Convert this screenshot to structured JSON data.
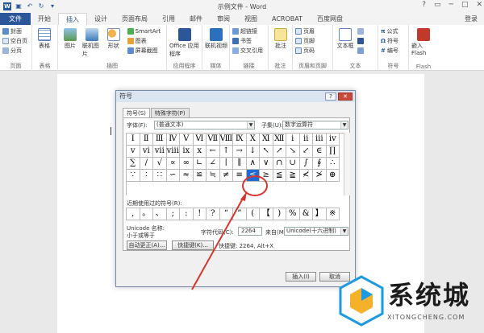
{
  "window": {
    "title": "示例文件 - Word",
    "login": "登录",
    "controls": [
      "?",
      "─",
      "□",
      "✕"
    ]
  },
  "tabs": [
    {
      "label": "文件",
      "kind": "file"
    },
    {
      "label": "开始",
      "kind": "normal"
    },
    {
      "label": "插入",
      "kind": "active"
    },
    {
      "label": "设计",
      "kind": "normal"
    },
    {
      "label": "页面布局",
      "kind": "normal"
    },
    {
      "label": "引用",
      "kind": "normal"
    },
    {
      "label": "邮件",
      "kind": "normal"
    },
    {
      "label": "审阅",
      "kind": "normal"
    },
    {
      "label": "视图",
      "kind": "normal"
    },
    {
      "label": "ACROBAT",
      "kind": "normal"
    },
    {
      "label": "百度网盘",
      "kind": "normal"
    }
  ],
  "ribbon": {
    "pages": {
      "label": "页面",
      "items": [
        "封面",
        "空白页",
        "分页"
      ]
    },
    "tables": {
      "label": "表格",
      "item": "表格"
    },
    "illustrations": {
      "label": "插图",
      "big": [
        "图片",
        "联机图片",
        "形状"
      ],
      "small": [
        "SmartArt",
        "图表",
        "屏幕截图"
      ]
    },
    "apps": {
      "label": "应用程序",
      "item": "Office 应用程序"
    },
    "media": {
      "label": "媒体",
      "item": "联机视频"
    },
    "links": {
      "label": "链接",
      "items": [
        "超链接",
        "书签",
        "交叉引用"
      ]
    },
    "comments": {
      "label": "批注",
      "item": "批注"
    },
    "header_footer": {
      "label": "页眉和页脚",
      "items": [
        "页眉",
        "页脚",
        "页码"
      ]
    },
    "text": {
      "label": "文本",
      "item": "文本框"
    },
    "symbols": {
      "label": "符号",
      "items": [
        "公式",
        "符号",
        "编号"
      ]
    },
    "flash": {
      "label": "Flash",
      "item": "嵌入 Flash"
    }
  },
  "dialog": {
    "title": "符号",
    "help": "?",
    "close": "✕",
    "tabs": [
      "符号(S)",
      "特殊字符(P)"
    ],
    "font_label": "字体(F):",
    "font_value": "(普通文本)",
    "subset_label": "子集(U):",
    "subset_value": "数字运算符",
    "symbols": [
      "Ⅰ",
      "Ⅱ",
      "Ⅲ",
      "Ⅳ",
      "Ⅴ",
      "Ⅵ",
      "Ⅶ",
      "Ⅷ",
      "Ⅸ",
      "Ⅹ",
      "Ⅺ",
      "Ⅻ",
      "ⅰ",
      "ⅱ",
      "ⅲ",
      "ⅳ",
      "ⅴ",
      "ⅵ",
      "ⅶ",
      "ⅷ",
      "ⅸ",
      "ⅹ",
      "←",
      "↑",
      "→",
      "↓",
      "↖",
      "↗",
      "↘",
      "↙",
      "∈",
      "∏",
      "∑",
      "∕",
      "√",
      "∝",
      "∞",
      "∟",
      "∠",
      "∣",
      "∥",
      "∧",
      "∨",
      "∩",
      "∪",
      "∫",
      "∮",
      "∴",
      "∵",
      "∶",
      "∷",
      "∽",
      "≈",
      "≌",
      "≒",
      "≠",
      "≡",
      "≤",
      "≥",
      "≦",
      "≧",
      "≮",
      "≯",
      "⊕"
    ],
    "selected_index": 57,
    "recent_label": "近期使用过的符号(R):",
    "recent": [
      ",",
      "。",
      "、",
      ";",
      ":",
      "!",
      "?",
      "“",
      "”",
      "(",
      "【",
      ")",
      "%",
      "&",
      "】",
      "※"
    ],
    "unicode_name_label": "Unicode 名称:",
    "unicode_name_value": "小于或等于",
    "char_code_label": "字符代码(C):",
    "char_code_value": "2264",
    "from_label": "来自(M):",
    "from_value": "Unicode(十六进制)",
    "autocorrect_btn": "自动更正(A)...",
    "shortcut_btn": "快捷键(K)...",
    "shortcut_text": "快捷键: 2264, Alt+X",
    "insert_btn": "插入(I)",
    "cancel_btn": "取消"
  },
  "watermark": {
    "text": "系统城",
    "sub": "XITONGCHENG.COM"
  },
  "colors": {
    "accent": "#2b579a",
    "highlight": "#1e6bd6",
    "annotation": "#d9342b"
  }
}
